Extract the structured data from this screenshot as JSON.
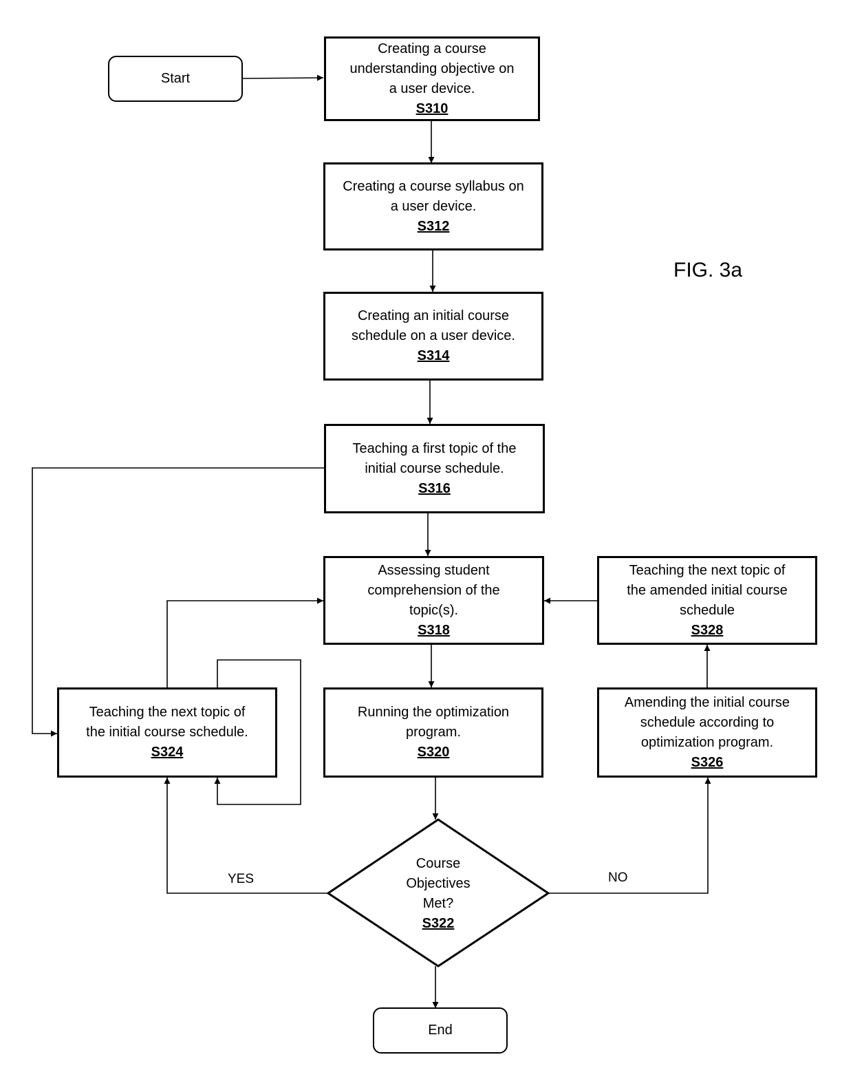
{
  "figure_label": "FIG. 3a",
  "terminals": {
    "start": "Start",
    "end": "End"
  },
  "steps": {
    "s310": {
      "lines": [
        "Creating a course",
        "understanding objective on",
        "a user device."
      ],
      "code": "S310"
    },
    "s312": {
      "lines": [
        "Creating a course syllabus on",
        "a user device."
      ],
      "code": "S312"
    },
    "s314": {
      "lines": [
        "Creating an initial course",
        "schedule on a user device."
      ],
      "code": "S314"
    },
    "s316": {
      "lines": [
        "Teaching a first topic of the",
        "initial course schedule."
      ],
      "code": "S316"
    },
    "s318": {
      "lines": [
        "Assessing student",
        "comprehension of the",
        "topic(s)."
      ],
      "code": "S318"
    },
    "s320": {
      "lines": [
        "Running the optimization",
        "program."
      ],
      "code": "S320"
    },
    "s322": {
      "lines": [
        "Course",
        "Objectives",
        "Met?"
      ],
      "code": "S322"
    },
    "s324": {
      "lines": [
        "Teaching the next topic of",
        "the initial course schedule."
      ],
      "code": "S324"
    },
    "s326": {
      "lines": [
        "Amending the initial course",
        "schedule according to",
        "optimization program."
      ],
      "code": "S326"
    },
    "s328": {
      "lines": [
        "Teaching the next topic  of",
        "the amended initial course",
        "schedule"
      ],
      "code": "S328"
    }
  },
  "branches": {
    "yes": "YES",
    "no": "NO"
  }
}
